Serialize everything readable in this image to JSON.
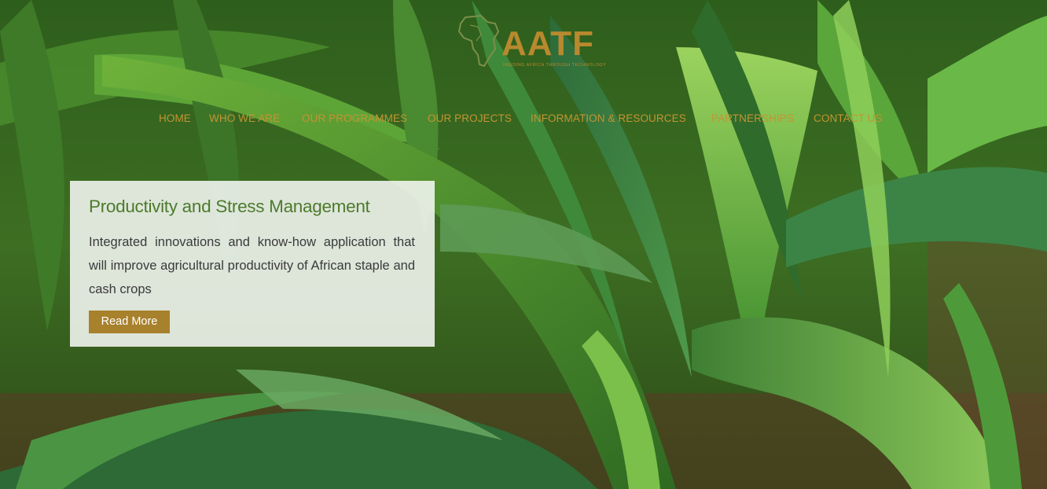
{
  "logo": {
    "name": "AATF",
    "tagline": "FEEDING AFRICA THROUGH TECHNOLOGY"
  },
  "nav": {
    "items": [
      {
        "label": "HOME"
      },
      {
        "label": "WHO WE ARE"
      },
      {
        "label": "OUR PROGRAMMES"
      },
      {
        "label": "OUR PROJECTS"
      },
      {
        "label": "INFORMATION & RESOURCES"
      },
      {
        "label": "PARTNERSHIPS"
      },
      {
        "label": "CONTACT US"
      }
    ]
  },
  "slide": {
    "title": "Productivity and Stress Management",
    "description": "Integrated innovations and know-how application that will improve agricultural productivity of African staple and cash crops",
    "button_label": "Read More"
  },
  "colors": {
    "brand_gold": "#b8892e",
    "nav_gold": "#c49432",
    "title_green": "#4d7a2c",
    "button_gold": "#a8812c"
  },
  "icons": {
    "logo_mark": "africa-map-icon"
  }
}
